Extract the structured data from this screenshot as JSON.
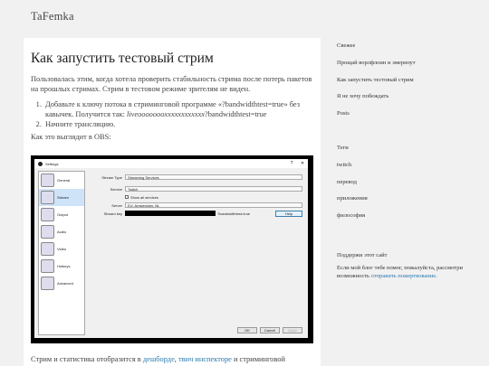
{
  "site": {
    "title": "TaFemka"
  },
  "post": {
    "title": "Как запустить тестовый стрим",
    "intro": "Пользовалась этим, когда хотела проверить стабильность стрима после потерь пакетов на прошлых стримах. Стрим в тестовом режиме зрителям не виден.",
    "step1_a": "Добавьте к ключу потока в стриминговой программе «?bandwidthtest=true» без кавычек. Получится так: ",
    "step1_em": "liveoooooooxxxxxxxxxxxx",
    "step1_b": "?bandwidthtest=true",
    "step2": "Начните трансляцию.",
    "obs_caption": "Как это выглядит в OBS:",
    "bottom_a": "Стрим и статистика отобразится в ",
    "bottom_link1": "дешборде",
    "bottom_sep": ", ",
    "bottom_link2": "твич инспекторе",
    "bottom_b": " и стриминговой"
  },
  "obs": {
    "window_title": "Settings",
    "controls": [
      "?",
      "✕"
    ],
    "sidebar": [
      "General",
      "Stream",
      "Output",
      "Audio",
      "Video",
      "Hotkeys",
      "Advanced"
    ],
    "stream_type_label": "Stream Type",
    "stream_type_value": "Streaming Services",
    "service_label": "Service",
    "service_value": "Twitch",
    "show_all": "Show all services",
    "server_label": "Server",
    "server_value": "EU: Amsterdam, NL",
    "key_label": "Stream key",
    "key_suffix": "?bandwidthtest=true",
    "help": "Help",
    "ok": "OK",
    "cancel": "Cancel",
    "apply": "Apply"
  },
  "sidebar": {
    "recent_heading": "Свежее",
    "recent": [
      "Прощай ворлфлоин и эмерноут",
      "Как запустить тестовый стрим",
      "Я не хочу побеждать",
      "Posts"
    ],
    "tags_heading": "Теги",
    "tags": [
      "twitch",
      "перевод",
      "приложения",
      "философия"
    ],
    "support_heading": "Поддержи этот сайт",
    "support_text": "Если мой блог тебе помог, пожалуйста, рассмотри возможность ",
    "support_link": "отправить пожертвование",
    "support_end": "."
  },
  "colors": {
    "link": "#2a7ab0",
    "background": "#f1f1f1",
    "content": "#ffffff"
  }
}
